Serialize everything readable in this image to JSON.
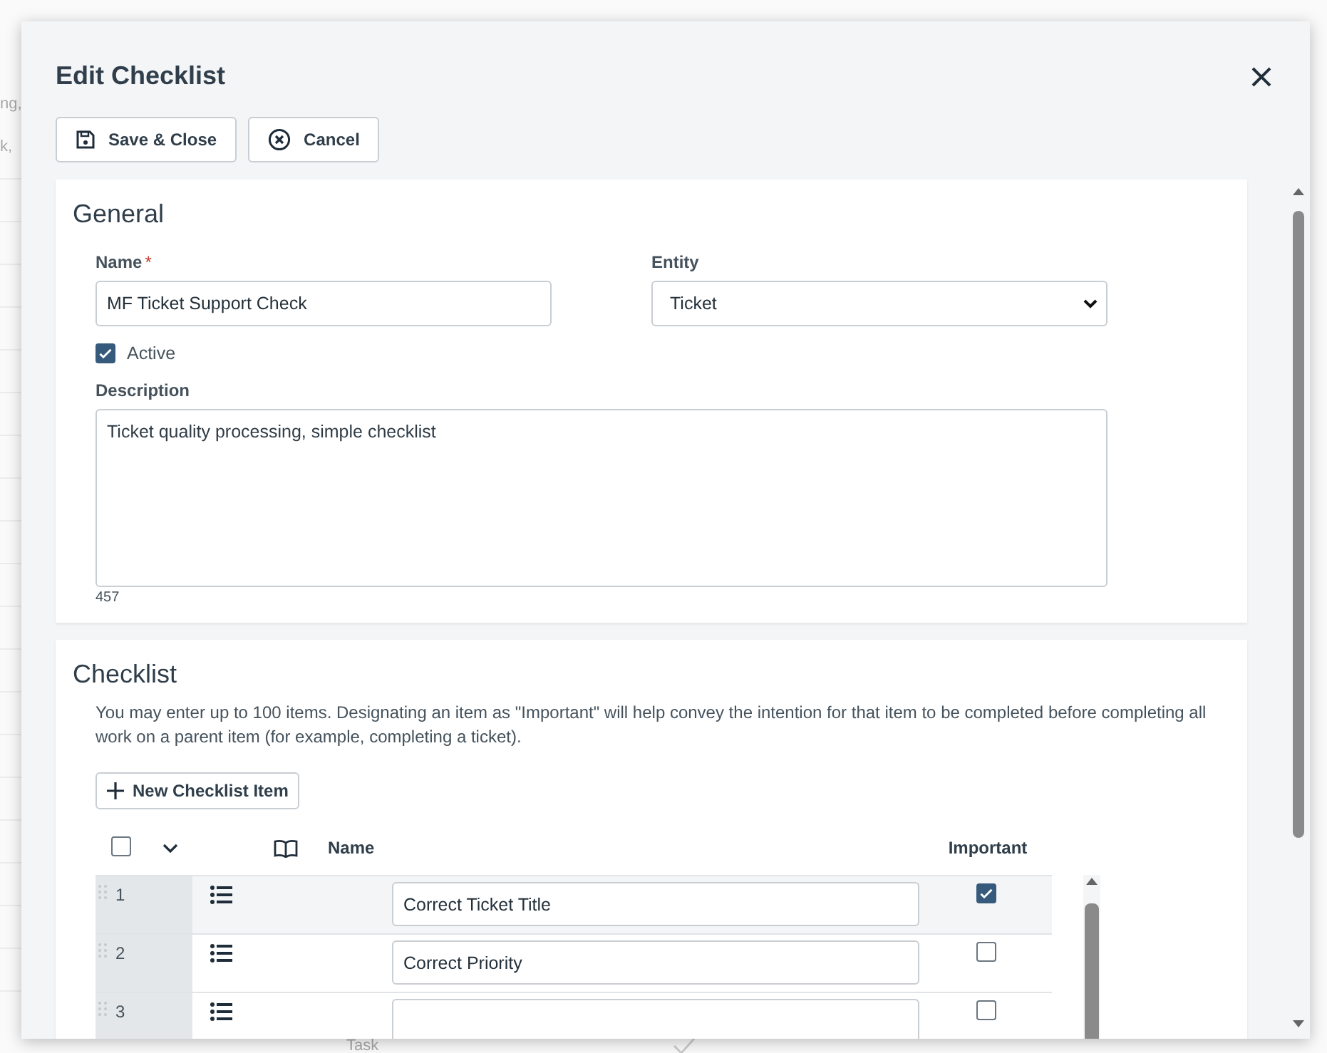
{
  "background": {
    "texts": [
      "ng,",
      "k,",
      "Task"
    ]
  },
  "dialog": {
    "title": "Edit Checklist",
    "buttons": [
      {
        "label": "Save & Close"
      },
      {
        "label": "Cancel"
      }
    ]
  },
  "general": {
    "title": "General",
    "name": {
      "label": "Name",
      "required_mark": "*",
      "value": "MF Ticket Support Check"
    },
    "entity": {
      "label": "Entity",
      "value": "Ticket"
    },
    "active": {
      "label": "Active",
      "checked": true
    },
    "description": {
      "label": "Description",
      "value": "Ticket quality processing, simple checklist",
      "counter": "457"
    }
  },
  "checklist": {
    "title": "Checklist",
    "note": "You may enter up to 100 items. Designating an item as \"Important\" will help convey the intention for that item to be completed before completing all work on a parent item (for example, completing a ticket).",
    "new_button": "New Checklist Item",
    "select_all": {
      "checked": false
    },
    "columns": [
      "Name",
      "Important"
    ],
    "rows": [
      {
        "number": "1",
        "name": "Correct Ticket Title",
        "important": true
      },
      {
        "number": "2",
        "name": "Correct Priority",
        "important": false
      },
      {
        "number": "3",
        "important": false
      }
    ]
  }
}
